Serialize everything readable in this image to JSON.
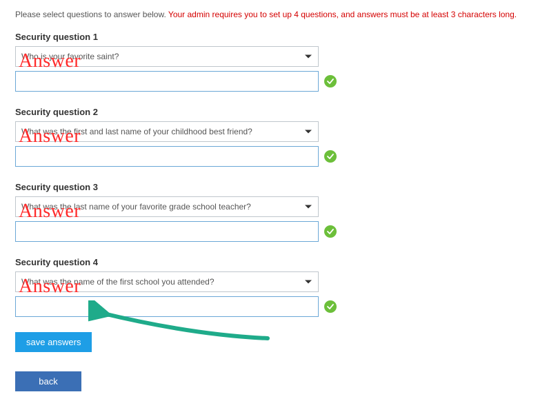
{
  "instruction": {
    "prefix": "Please select questions to answer below. ",
    "warning": "Your admin requires you to set up 4 questions, and answers must be at least 3 characters long."
  },
  "questions": [
    {
      "label": "Security question 1",
      "selected": "Who is your favorite saint?",
      "callout": "Answer"
    },
    {
      "label": "Security question 2",
      "selected": "What was the first and last name of your childhood best friend?",
      "callout": "Answer"
    },
    {
      "label": "Security question 3",
      "selected": "What was the last name of your favorite grade school teacher?",
      "callout": "Answer"
    },
    {
      "label": "Security question 4",
      "selected": "What was the name of the first school you attended?",
      "callout": "Answer"
    }
  ],
  "buttons": {
    "save": "save answers",
    "back": "back"
  },
  "icons": {
    "check": "checkmark-icon",
    "caret": "chevron-down-icon"
  },
  "colors": {
    "warning": "#d40000",
    "ok": "#6cbf3a",
    "primary": "#1e9ee6",
    "secondary": "#3b6fb5",
    "arrow": "#1fab8a"
  }
}
